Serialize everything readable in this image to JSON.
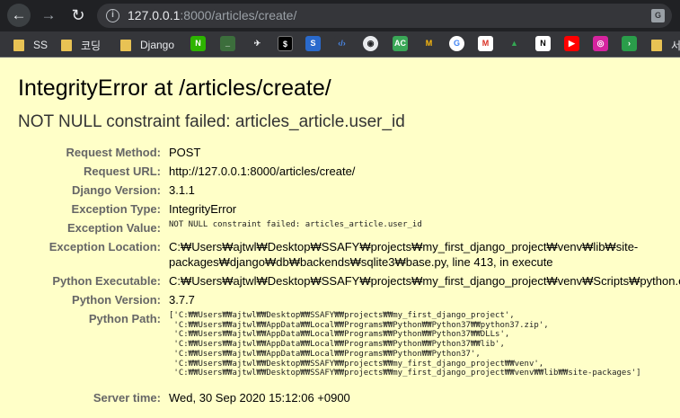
{
  "browser": {
    "url_host": "127.0.0.1",
    "url_rest": ":8000/articles/create/",
    "bookmarks": [
      {
        "label": "SS"
      },
      {
        "label": "코딩"
      },
      {
        "label": "Django"
      }
    ],
    "overflow_bookmark": "서"
  },
  "error": {
    "title": "IntegrityError at /articles/create/",
    "subtitle": "NOT NULL constraint failed: articles_article.user_id"
  },
  "meta": {
    "request_method_label": "Request Method:",
    "request_method": "POST",
    "request_url_label": "Request URL:",
    "request_url": "http://127.0.0.1:8000/articles/create/",
    "django_version_label": "Django Version:",
    "django_version": "3.1.1",
    "exception_type_label": "Exception Type:",
    "exception_type": "IntegrityError",
    "exception_value_label": "Exception Value:",
    "exception_value": "NOT NULL constraint failed: articles_article.user_id",
    "exception_location_label": "Exception Location:",
    "exception_location_line1": "C:₩Users₩ajtwl₩Desktop₩SSAFY₩projects₩my_first_django_project₩venv₩lib₩site-",
    "exception_location_line2": "packages₩django₩db₩backends₩sqlite3₩base.py, line 413, in execute",
    "python_executable_label": "Python Executable:",
    "python_executable": "C:₩Users₩ajtwl₩Desktop₩SSAFY₩projects₩my_first_django_project₩venv₩Scripts₩python.exe",
    "python_version_label": "Python Version:",
    "python_version": "3.7.7",
    "python_path_label": "Python Path:",
    "python_path": "['C:₩₩Users₩₩ajtwl₩₩Desktop₩₩SSAFY₩₩projects₩₩my_first_django_project',\n 'C:₩₩Users₩₩ajtwl₩₩AppData₩₩Local₩₩Programs₩₩Python₩₩Python37₩₩python37.zip',\n 'C:₩₩Users₩₩ajtwl₩₩AppData₩₩Local₩₩Programs₩₩Python₩₩Python37₩₩DLLs',\n 'C:₩₩Users₩₩ajtwl₩₩AppData₩₩Local₩₩Programs₩₩Python₩₩Python37₩₩lib',\n 'C:₩₩Users₩₩ajtwl₩₩AppData₩₩Local₩₩Programs₩₩Python₩₩Python37',\n 'C:₩₩Users₩₩ajtwl₩₩Desktop₩₩SSAFY₩₩projects₩₩my_first_django_project₩₩venv',\n 'C:₩₩Users₩₩ajtwl₩₩Desktop₩₩SSAFY₩₩projects₩₩my_first_django_project₩₩venv₩₩lib₩₩site-packages']",
    "server_time_label": "Server time:",
    "server_time": "Wed, 30 Sep 2020 15:12:06 +0900"
  }
}
